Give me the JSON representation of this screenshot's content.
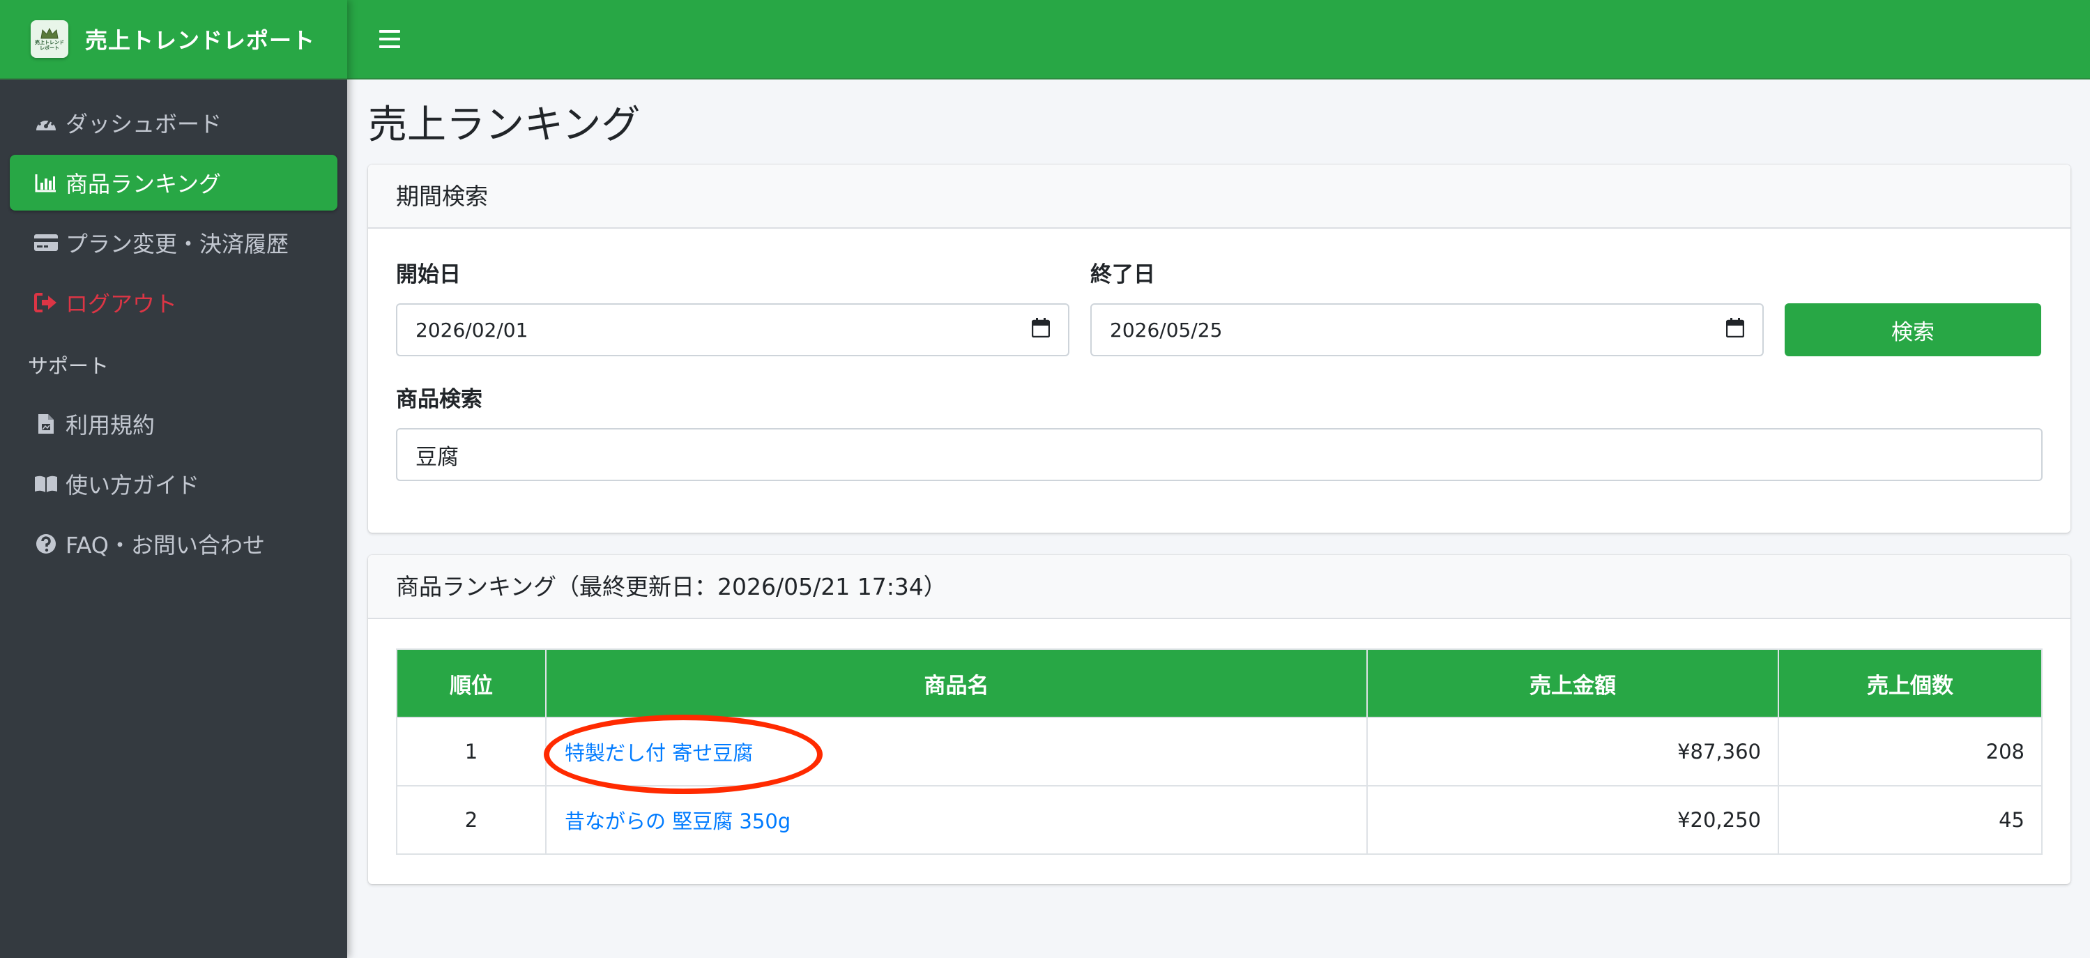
{
  "brand": {
    "title": "売上トレンドレポート",
    "logo_text_1": "売上トレンド",
    "logo_text_2": "レポート"
  },
  "sidebar": {
    "items": [
      {
        "label": "ダッシュボード",
        "icon": "tachometer-icon"
      },
      {
        "label": "商品ランキング",
        "icon": "bar-chart-icon",
        "active": true
      },
      {
        "label": "プラン変更・決済履歴",
        "icon": "credit-card-icon"
      },
      {
        "label": "ログアウト",
        "icon": "sign-out-icon"
      }
    ],
    "support_header": "サポート",
    "support_items": [
      {
        "label": "利用規約",
        "icon": "document-icon"
      },
      {
        "label": "使い方ガイド",
        "icon": "book-icon"
      },
      {
        "label": "FAQ・お問い合わせ",
        "icon": "question-circle-icon"
      }
    ]
  },
  "page": {
    "title": "売上ランキング"
  },
  "search_card": {
    "header": "期間検索",
    "start_label": "開始日",
    "start_value": "2026/02/01",
    "end_label": "終了日",
    "end_value": "2026/05/25",
    "search_button": "検索",
    "product_label": "商品検索",
    "product_value": "豆腐"
  },
  "ranking_card": {
    "header": "商品ランキング（最終更新日：2026/05/21 17:34）",
    "columns": [
      "順位",
      "商品名",
      "売上金額",
      "売上個数"
    ],
    "rows": [
      {
        "rank": "1",
        "name": "特製だし付 寄せ豆腐",
        "amount": "¥87,360",
        "count": "208"
      },
      {
        "rank": "2",
        "name": "昔ながらの 堅豆腐 350g",
        "amount": "¥20,250",
        "count": "45"
      }
    ]
  },
  "colors": {
    "primary": "#28a745",
    "sidebar_bg": "#343a40",
    "link": "#007bff",
    "danger": "#dc3545",
    "annotation": "#ff2a00"
  }
}
